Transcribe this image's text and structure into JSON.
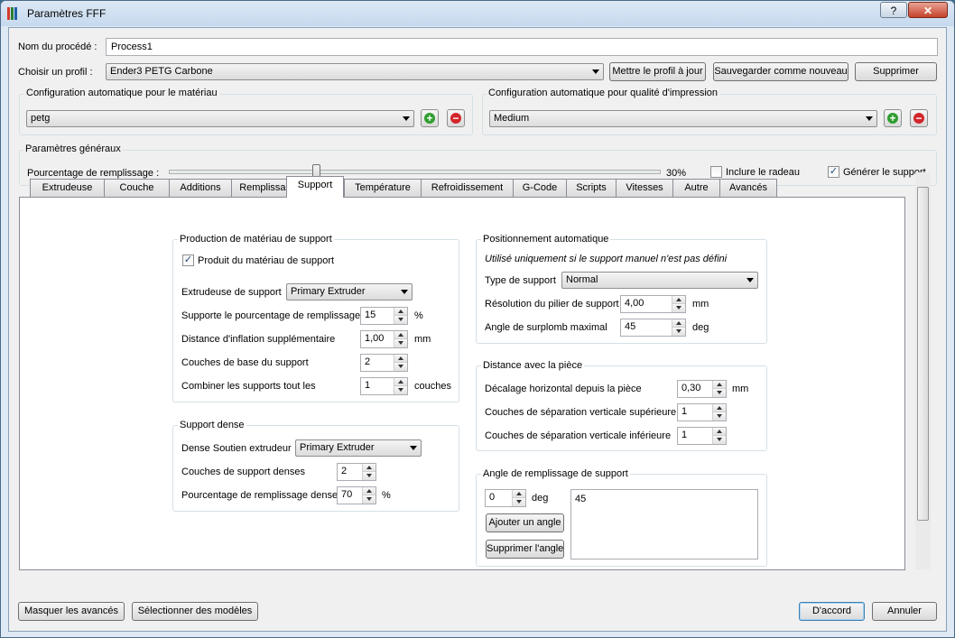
{
  "window": {
    "title": "Paramètres FFF",
    "help_label": "?",
    "close_label": "✕"
  },
  "process": {
    "name_label": "Nom du procédé :",
    "name_value": "Process1"
  },
  "profile": {
    "label": "Choisir un profil :",
    "selected": "Ender3 PETG Carbone",
    "update_button": "Mettre le profil à jour",
    "save_new_button": "Sauvegarder comme nouveau",
    "delete_button": "Supprimer"
  },
  "auto_material": {
    "title": "Configuration automatique pour le matériau",
    "selected": "petg"
  },
  "auto_quality": {
    "title": "Configuration automatique pour qualité d'impression",
    "selected": "Medium"
  },
  "general": {
    "title": "Paramètres généraux",
    "infill_label": "Pourcentage de remplissage :",
    "infill_value_text": "30%",
    "infill_fraction": 0.3,
    "raft_label": "Inclure le radeau",
    "raft_checked": false,
    "support_label": "Générer le support",
    "support_checked": true
  },
  "tabs": [
    {
      "label": "Extrudeuse"
    },
    {
      "label": "Couche"
    },
    {
      "label": "Additions"
    },
    {
      "label": "Remplissage"
    },
    {
      "label": "Support",
      "active": true
    },
    {
      "label": "Température"
    },
    {
      "label": "Refroidissement"
    },
    {
      "label": "G-Code"
    },
    {
      "label": "Scripts"
    },
    {
      "label": "Vitesses"
    },
    {
      "label": "Autre"
    },
    {
      "label": "Avancés"
    }
  ],
  "support_material": {
    "title": "Production de matériau de support",
    "generate_label": "Produit du matériau de support",
    "generate_checked": true,
    "extruder_label": "Extrudeuse de support",
    "extruder_value": "Primary Extruder",
    "infill_label": "Supporte le pourcentage de remplissage",
    "infill_value": "15",
    "infill_unit": "%",
    "inflation_label": "Distance d'inflation supplémentaire",
    "inflation_value": "1,00",
    "inflation_unit": "mm",
    "base_layers_label": "Couches de base du support",
    "base_layers_value": "2",
    "combine_label": "Combiner les supports tout les",
    "combine_value": "1",
    "combine_unit": "couches"
  },
  "dense_support": {
    "title": "Support dense",
    "extruder_label": "Dense Soutien extrudeur",
    "extruder_value": "Primary Extruder",
    "layers_label": "Couches de support denses",
    "layers_value": "2",
    "infill_label": "Pourcentage de remplissage dense",
    "infill_value": "70",
    "infill_unit": "%"
  },
  "auto_placement": {
    "title": "Positionnement automatique",
    "note": "Utilisé uniquement si le support manuel n'est pas défini",
    "type_label": "Type de support",
    "type_value": "Normal",
    "resolution_label": "Résolution du pilier de support",
    "resolution_value": "4,00",
    "resolution_unit": "mm",
    "overhang_label": "Angle de surplomb maximal",
    "overhang_value": "45",
    "overhang_unit": "deg"
  },
  "part_distance": {
    "title": "Distance avec la pièce",
    "horizontal_label": "Décalage horizontal depuis la pièce",
    "horizontal_value": "0,30",
    "horizontal_unit": "mm",
    "upper_label": "Couches de séparation verticale supérieure",
    "upper_value": "1",
    "lower_label": "Couches de séparation verticale inférieure",
    "lower_value": "1"
  },
  "infill_angle": {
    "title": "Angle de remplissage de support",
    "angle_value": "0",
    "angle_unit": "deg",
    "add_button": "Ajouter un angle",
    "remove_button": "Supprimer l'angle",
    "angles": [
      "45"
    ]
  },
  "footer": {
    "hide_advanced_button": "Masquer les avancés",
    "select_models_button": "Sélectionner des modèles",
    "ok_button": "D'accord",
    "cancel_button": "Annuler"
  },
  "colors": {
    "add": "#2f9e2f",
    "remove": "#d2262b"
  }
}
